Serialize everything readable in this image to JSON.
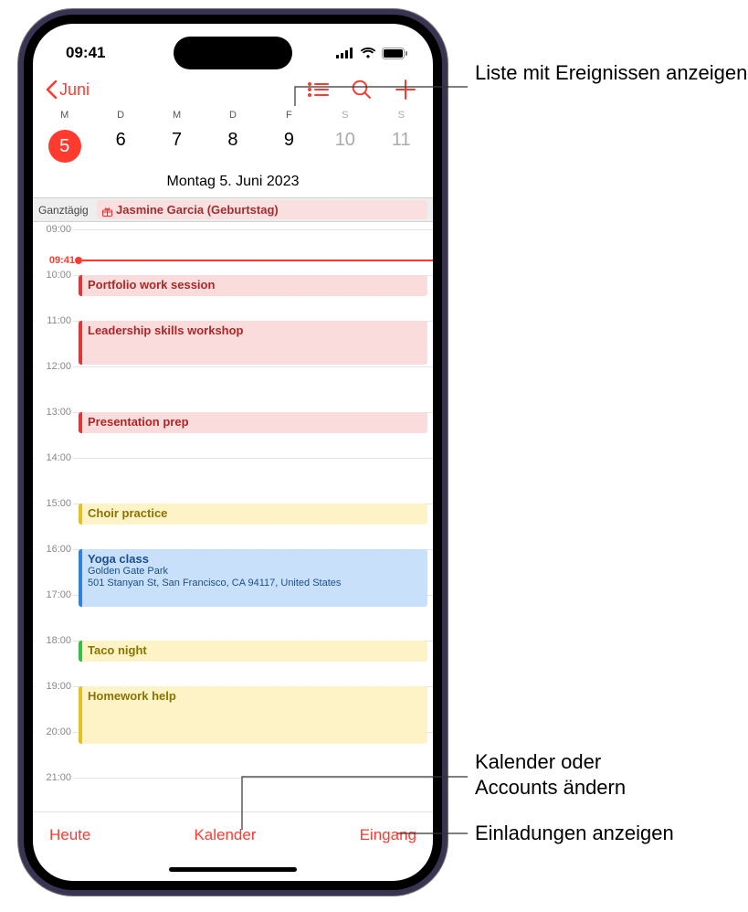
{
  "status": {
    "time": "09:41"
  },
  "nav": {
    "back_label": "Juni"
  },
  "week": {
    "day_labels": [
      "M",
      "D",
      "M",
      "D",
      "F",
      "S",
      "S"
    ],
    "dates": [
      "5",
      "6",
      "7",
      "8",
      "9",
      "10",
      "11"
    ],
    "selected_index": 0,
    "title": "Montag  5. Juni 2023"
  },
  "allday": {
    "label": "Ganztägig",
    "event_title": "Jasmine Garcia (Geburtstag)"
  },
  "now": {
    "label": "09:41"
  },
  "hours": [
    "09:00",
    "10:00",
    "11:00",
    "12:00",
    "13:00",
    "14:00",
    "15:00",
    "16:00",
    "17:00",
    "18:00",
    "19:00",
    "20:00",
    "21:00"
  ],
  "events": [
    {
      "title": "Portfolio work session",
      "color": "red",
      "start": 10,
      "end": 10.5
    },
    {
      "title": "Leadership skills workshop",
      "color": "red",
      "start": 11,
      "end": 12
    },
    {
      "title": "Presentation prep",
      "color": "red",
      "start": 13,
      "end": 13.5
    },
    {
      "title": "Choir practice",
      "color": "yellow",
      "start": 15,
      "end": 15.5
    },
    {
      "title": "Yoga class",
      "sub1": "Golden Gate Park",
      "sub2": "501 Stanyan St, San Francisco, CA 94117, United States",
      "color": "blue",
      "start": 16,
      "end": 17.3
    },
    {
      "title": "Taco night",
      "color": "green",
      "start": 18,
      "end": 18.5
    },
    {
      "title": "Homework help",
      "color": "yellow",
      "start": 19,
      "end": 20.3
    }
  ],
  "toolbar": {
    "today": "Heute",
    "calendars": "Kalender",
    "inbox": "Eingang"
  },
  "callouts": {
    "list": "Liste mit Ereignissen anzeigen",
    "accounts_l1": "Kalender oder",
    "accounts_l2": "Accounts ändern",
    "invites": "Einladungen anzeigen"
  }
}
